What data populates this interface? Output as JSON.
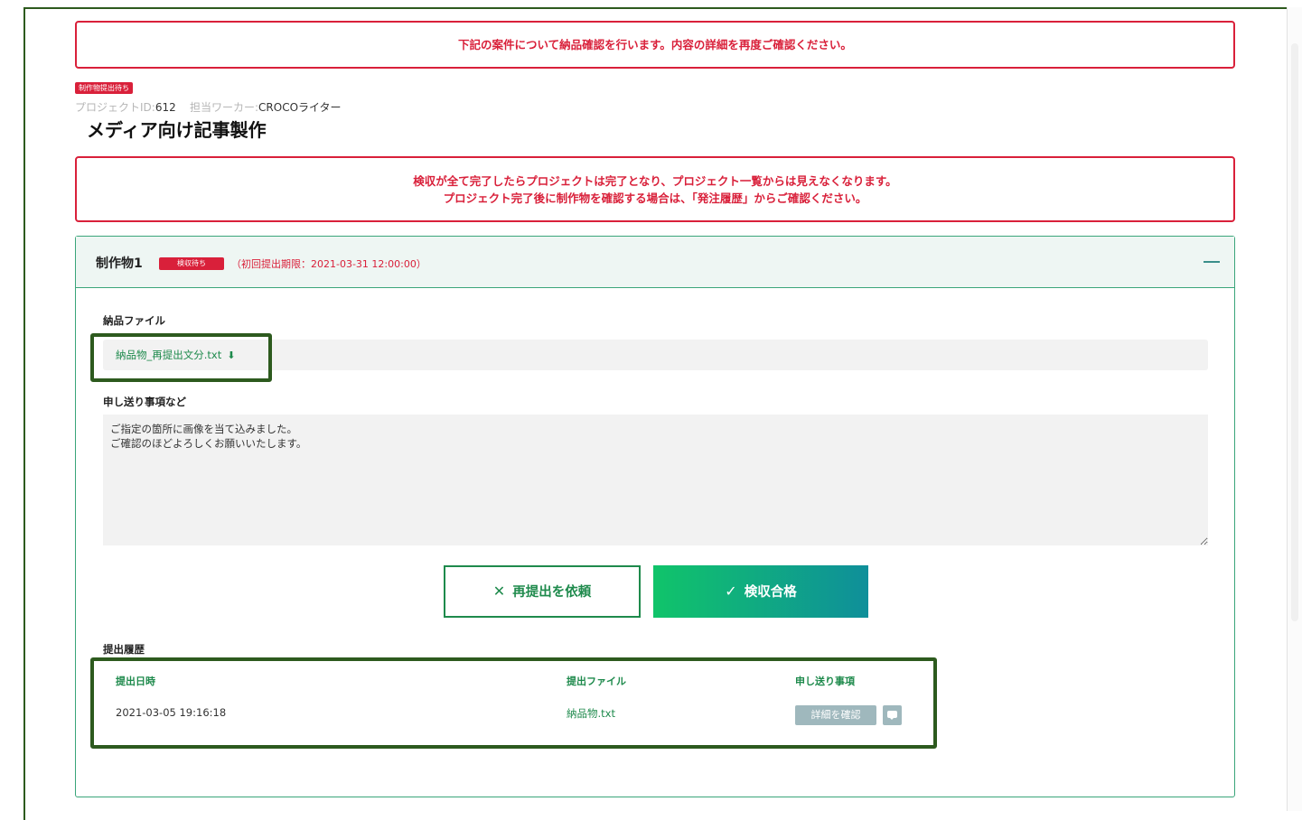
{
  "alerts": {
    "top": "下記の案件について納品確認を行います。内容の詳細を再度ご確認ください。",
    "completion_line1": "検収が全て完了したらプロジェクトは完了となり、プロジェクト一覧からは見えなくなります。",
    "completion_line2": "プロジェクト完了後に制作物を確認する場合は、「発注履歴」からご確認ください。"
  },
  "project": {
    "status_badge": "制作物提出待ち",
    "id_label": "プロジェクトID:",
    "id_value": "612",
    "worker_label": "担当ワーカー:",
    "worker_value": "CROCOライター",
    "title": "メディア向け記事製作"
  },
  "deliverable": {
    "title": "制作物1",
    "status_badge": "検収待ち",
    "deadline": "（初回提出期限：2021-03-31 12:00:00）",
    "file_section_label": "納品ファイル",
    "file_name": "納品物_再提出文分.txt",
    "notes_label": "申し送り事項など",
    "notes_text": "ご指定の箇所に画像を当て込みました。\nご確認のほどよろしくお願いいたします。",
    "resubmit_label": "再提出を依頼",
    "accept_label": "検収合格"
  },
  "history": {
    "section_label": "提出履歴",
    "columns": [
      "提出日時",
      "提出ファイル",
      "申し送り事項"
    ],
    "rows": [
      {
        "date": "2021-03-05 19:16:18",
        "file": "納品物.txt",
        "detail_button": "詳細を確認"
      }
    ]
  },
  "icons": {
    "download": "download-icon",
    "close": "close-icon",
    "check": "check-icon",
    "collapse": "minus-icon",
    "chat": "chat-icon"
  },
  "colors": {
    "alert_red": "#d9203a",
    "brand_green": "#1e8a4c",
    "accent_teal": "#0f8f9a",
    "highlight_dark_green": "#2d5a1e"
  }
}
